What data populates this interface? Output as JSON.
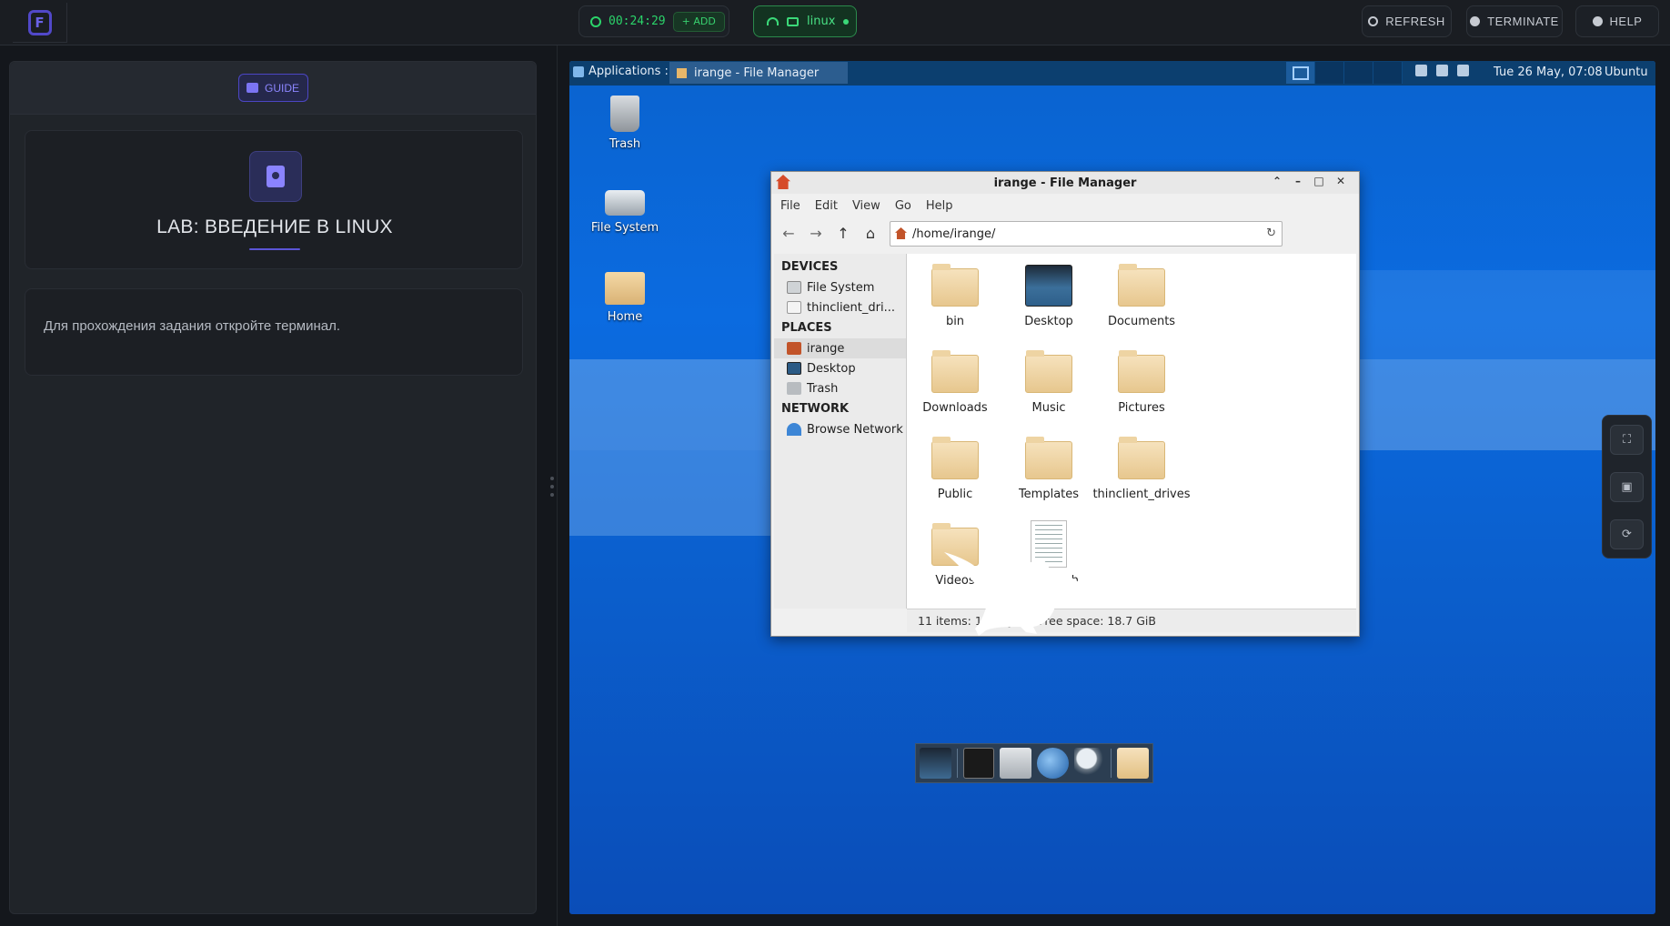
{
  "topbar": {
    "timer": "00:24:29",
    "add_label": "+ ADD",
    "os_label": "linux",
    "refresh_label": "REFRESH",
    "terminate_label": "TERMINATE",
    "help_label": "HELP"
  },
  "guide": {
    "tab_label": "GUIDE",
    "lab_title": "LAB: ВВЕДЕНИЕ В LINUX",
    "task_text": "Для прохождения задания откройте терминал."
  },
  "xfce_panel": {
    "applications_label": "Applications :",
    "task_label": "irange - File Manager",
    "clock": "Tue 26 May, 07:08",
    "user": "Ubuntu"
  },
  "desktop_icons": [
    {
      "label": "Trash",
      "icon": "trash-icon"
    },
    {
      "label": "File System",
      "icon": "drive-icon"
    },
    {
      "label": "Home",
      "icon": "home-folder-icon"
    }
  ],
  "file_manager": {
    "title": "irange - File Manager",
    "menu": [
      "File",
      "Edit",
      "View",
      "Go",
      "Help"
    ],
    "path": "/home/irange/",
    "sidebar": {
      "devices_header": "DEVICES",
      "devices": [
        "File System",
        "thinclient_dri..."
      ],
      "places_header": "PLACES",
      "places": [
        "irange",
        "Desktop",
        "Trash"
      ],
      "network_header": "NETWORK",
      "network": [
        "Browse Network"
      ]
    },
    "items": [
      {
        "name": "bin",
        "kind": "folder"
      },
      {
        "name": "Desktop",
        "kind": "desktop"
      },
      {
        "name": "Documents",
        "kind": "folder"
      },
      {
        "name": "Downloads",
        "kind": "folder"
      },
      {
        "name": "Music",
        "kind": "folder"
      },
      {
        "name": "Pictures",
        "kind": "folder"
      },
      {
        "name": "Public",
        "kind": "folder"
      },
      {
        "name": "Templates",
        "kind": "folder"
      },
      {
        "name": "thinclient_drives",
        "kind": "folder"
      },
      {
        "name": "Videos",
        "kind": "folder"
      },
      {
        "name": "startup.sh",
        "kind": "script"
      }
    ],
    "status": "11 items: 186 bytes, Free space: 18.7 GiB"
  },
  "colors": {
    "accent": "#5b55d6",
    "success": "#2bd46a",
    "desktop_blue": "#0b6be0"
  }
}
